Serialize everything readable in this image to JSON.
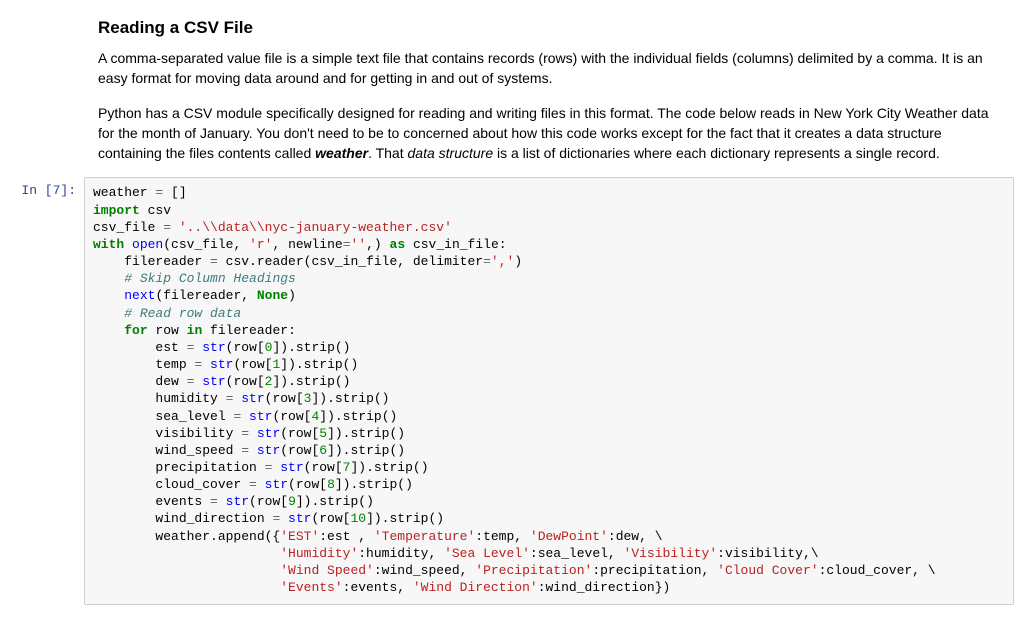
{
  "markdown": {
    "heading": "Reading a CSV File",
    "p1": "A comma-separated value file is a simple text file that contains records (rows) with the individual fields (columns) delimited by a comma. It is an easy format for moving data around and for getting in and out of systems.",
    "p2a": "Python has a CSV module specifically designed for reading and writing files in this format. The code below reads in New York City Weather data for the month of January. You don't need to be to concerned about how this code works except for the fact that it creates a data structure containing the files contents called ",
    "p2_bold_italic": "weather",
    "p2b": ". That ",
    "p2_italic": "data structure",
    "p2c": " is a list of dictionaries where each dictionary represents a single record."
  },
  "cell": {
    "prompt": "In [7]:",
    "code_tokens": [
      [
        "",
        "weather "
      ],
      [
        "op",
        "= "
      ],
      [
        "",
        "[]\n"
      ],
      [
        "bi",
        "import"
      ],
      [
        "",
        " csv\n"
      ],
      [
        "",
        "csv_file "
      ],
      [
        "op",
        "= "
      ],
      [
        "str",
        "'..\\\\data\\\\nyc-january-weather.csv'"
      ],
      [
        "",
        "\n"
      ],
      [
        "bi",
        "with"
      ],
      [
        "",
        " "
      ],
      [
        "fn",
        "open"
      ],
      [
        "",
        "(csv_file, "
      ],
      [
        "str",
        "'r'"
      ],
      [
        "",
        ", newline"
      ],
      [
        "op",
        "="
      ],
      [
        "str",
        "''"
      ],
      [
        "",
        ",) "
      ],
      [
        "bi",
        "as"
      ],
      [
        "",
        " csv_in_file:\n"
      ],
      [
        "",
        "    filereader "
      ],
      [
        "op",
        "= "
      ],
      [
        "",
        "csv.reader(csv_in_file, delimiter"
      ],
      [
        "op",
        "="
      ],
      [
        "str",
        "','"
      ],
      [
        "",
        ")\n"
      ],
      [
        "",
        "    "
      ],
      [
        "cmt",
        "# Skip Column Headings"
      ],
      [
        "",
        "\n"
      ],
      [
        "",
        "    "
      ],
      [
        "fn",
        "next"
      ],
      [
        "",
        "(filereader, "
      ],
      [
        "kc",
        "None"
      ],
      [
        "",
        ")\n"
      ],
      [
        "",
        "    "
      ],
      [
        "cmt",
        "# Read row data"
      ],
      [
        "",
        "\n"
      ],
      [
        "",
        "    "
      ],
      [
        "bi",
        "for"
      ],
      [
        "",
        " row "
      ],
      [
        "bi",
        "in"
      ],
      [
        "",
        " filereader:\n"
      ],
      [
        "",
        "        est "
      ],
      [
        "op",
        "= "
      ],
      [
        "fn",
        "str"
      ],
      [
        "",
        "(row["
      ],
      [
        "num",
        "0"
      ],
      [
        "",
        "]).strip()\n"
      ],
      [
        "",
        "        temp "
      ],
      [
        "op",
        "= "
      ],
      [
        "fn",
        "str"
      ],
      [
        "",
        "(row["
      ],
      [
        "num",
        "1"
      ],
      [
        "",
        "]).strip()\n"
      ],
      [
        "",
        "        dew "
      ],
      [
        "op",
        "= "
      ],
      [
        "fn",
        "str"
      ],
      [
        "",
        "(row["
      ],
      [
        "num",
        "2"
      ],
      [
        "",
        "]).strip()\n"
      ],
      [
        "",
        "        humidity "
      ],
      [
        "op",
        "= "
      ],
      [
        "fn",
        "str"
      ],
      [
        "",
        "(row["
      ],
      [
        "num",
        "3"
      ],
      [
        "",
        "]).strip()\n"
      ],
      [
        "",
        "        sea_level "
      ],
      [
        "op",
        "= "
      ],
      [
        "fn",
        "str"
      ],
      [
        "",
        "(row["
      ],
      [
        "num",
        "4"
      ],
      [
        "",
        "]).strip()\n"
      ],
      [
        "",
        "        visibility "
      ],
      [
        "op",
        "= "
      ],
      [
        "fn",
        "str"
      ],
      [
        "",
        "(row["
      ],
      [
        "num",
        "5"
      ],
      [
        "",
        "]).strip()\n"
      ],
      [
        "",
        "        wind_speed "
      ],
      [
        "op",
        "= "
      ],
      [
        "fn",
        "str"
      ],
      [
        "",
        "(row["
      ],
      [
        "num",
        "6"
      ],
      [
        "",
        "]).strip()\n"
      ],
      [
        "",
        "        precipitation "
      ],
      [
        "op",
        "= "
      ],
      [
        "fn",
        "str"
      ],
      [
        "",
        "(row["
      ],
      [
        "num",
        "7"
      ],
      [
        "",
        "]).strip()\n"
      ],
      [
        "",
        "        cloud_cover "
      ],
      [
        "op",
        "= "
      ],
      [
        "fn",
        "str"
      ],
      [
        "",
        "(row["
      ],
      [
        "num",
        "8"
      ],
      [
        "",
        "]).strip()\n"
      ],
      [
        "",
        "        events "
      ],
      [
        "op",
        "= "
      ],
      [
        "fn",
        "str"
      ],
      [
        "",
        "(row["
      ],
      [
        "num",
        "9"
      ],
      [
        "",
        "]).strip()\n"
      ],
      [
        "",
        "        wind_direction "
      ],
      [
        "op",
        "= "
      ],
      [
        "fn",
        "str"
      ],
      [
        "",
        "(row["
      ],
      [
        "num",
        "10"
      ],
      [
        "",
        "]).strip()\n"
      ],
      [
        "",
        "        weather.append({"
      ],
      [
        "str",
        "'EST'"
      ],
      [
        "",
        ":est , "
      ],
      [
        "str",
        "'Temperature'"
      ],
      [
        "",
        ":temp, "
      ],
      [
        "str",
        "'DewPoint'"
      ],
      [
        "",
        ":dew, \\\n"
      ],
      [
        "",
        "                        "
      ],
      [
        "str",
        "'Humidity'"
      ],
      [
        "",
        ":humidity, "
      ],
      [
        "str",
        "'Sea Level'"
      ],
      [
        "",
        ":sea_level, "
      ],
      [
        "str",
        "'Visibility'"
      ],
      [
        "",
        ":visibility,\\\n"
      ],
      [
        "",
        "                        "
      ],
      [
        "str",
        "'Wind Speed'"
      ],
      [
        "",
        ":wind_speed, "
      ],
      [
        "str",
        "'Precipitation'"
      ],
      [
        "",
        ":precipitation, "
      ],
      [
        "str",
        "'Cloud Cover'"
      ],
      [
        "",
        ":cloud_cover, \\\n"
      ],
      [
        "",
        "                        "
      ],
      [
        "str",
        "'Events'"
      ],
      [
        "",
        ":events, "
      ],
      [
        "str",
        "'Wind Direction'"
      ],
      [
        "",
        ":wind_direction})"
      ]
    ]
  }
}
